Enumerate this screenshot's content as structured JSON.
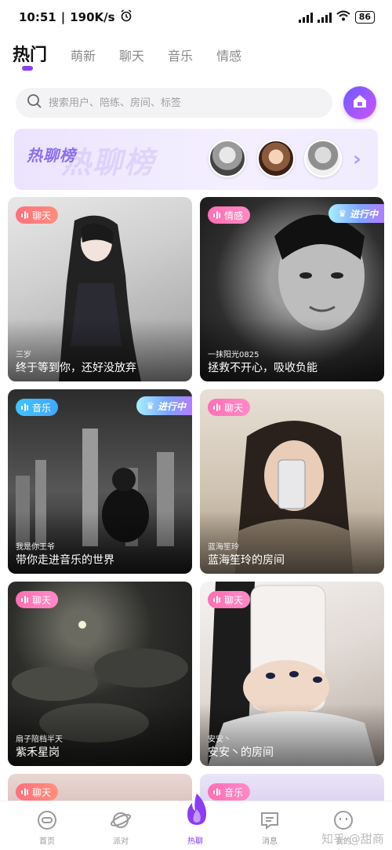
{
  "status_bar": {
    "time": "10:51",
    "speed": "190K/s",
    "battery": "86"
  },
  "tabs": [
    {
      "label": "热门",
      "active": true
    },
    {
      "label": "萌新",
      "active": false
    },
    {
      "label": "聊天",
      "active": false
    },
    {
      "label": "音乐",
      "active": false
    },
    {
      "label": "情感",
      "active": false
    }
  ],
  "search": {
    "placeholder": "搜索用户、陪练、房间、标签"
  },
  "banner": {
    "title": "热聊榜",
    "ghost": "热聊榜"
  },
  "cards": [
    {
      "badge": "聊天",
      "badge_type": "chat",
      "live": "",
      "owner": "三岁",
      "room": "终于等到你，还好没放弃"
    },
    {
      "badge": "情感",
      "badge_type": "emo",
      "live": "进行中",
      "owner": "一抹阳光0825",
      "room": "拯救不开心，吸收负能"
    },
    {
      "badge": "音乐",
      "badge_type": "music",
      "live": "进行中",
      "owner": "我是你王爷",
      "room": "带你走进音乐的世界"
    },
    {
      "badge": "聊天",
      "badge_type": "emo",
      "live": "",
      "owner": "蓝海笙玲",
      "room": "蓝海笙玲的房间"
    },
    {
      "badge": "聊天",
      "badge_type": "emo",
      "live": "",
      "owner": "扇子陪档半天",
      "room": "紫禾星岗"
    },
    {
      "badge": "聊天",
      "badge_type": "emo",
      "live": "",
      "owner": "安安丶",
      "room": "安安丶的房间"
    },
    {
      "badge": "聊天",
      "badge_type": "chat",
      "live": "",
      "owner": "",
      "room": ""
    },
    {
      "badge": "音乐",
      "badge_type": "emo",
      "live": "",
      "owner": "",
      "room": ""
    }
  ],
  "nav": [
    {
      "label": "首页",
      "icon": "home-icon",
      "active": false
    },
    {
      "label": "派对",
      "icon": "planet-icon",
      "active": false
    },
    {
      "label": "热聊",
      "icon": "flame-icon",
      "active": true
    },
    {
      "label": "消息",
      "icon": "message-icon",
      "active": false
    },
    {
      "label": "我的",
      "icon": "profile-icon",
      "active": false
    }
  ],
  "watermark": "知乎 @甜商语音",
  "colors": {
    "accent": "#8b3df5",
    "chat_badge": "#ff6f7b",
    "emotion_badge": "#ff6fb4",
    "music_badge": "#3fc4ff"
  }
}
